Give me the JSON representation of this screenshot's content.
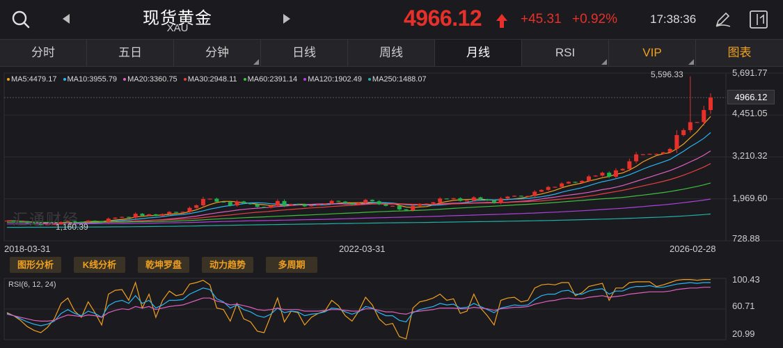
{
  "header": {
    "title": "现货黄金",
    "symbol": "XAU",
    "price": "4966.12",
    "change": "+45.31",
    "change_pct": "+0.92%",
    "time": "17:38:36",
    "colors": {
      "up": "#e8302a",
      "down": "#22b14c",
      "accent": "#f0a020"
    }
  },
  "icons": {
    "search": "search-icon",
    "prev": "chevron-left-icon",
    "next": "chevron-right-icon",
    "up_arrow": "arrow-up-icon",
    "draw": "pen-icon",
    "layout": "window-toggle-icon"
  },
  "tabs": [
    {
      "label": "分时",
      "active": false
    },
    {
      "label": "五日",
      "active": false
    },
    {
      "label": "分钟",
      "active": false
    },
    {
      "label": "日线",
      "active": false
    },
    {
      "label": "周线",
      "active": false
    },
    {
      "label": "月线",
      "active": true
    },
    {
      "label": "RSI",
      "active": false
    },
    {
      "label": "VIP",
      "active": false
    },
    {
      "label": "图表",
      "active": false
    }
  ],
  "ma": [
    {
      "label": "MA5:4479.17",
      "color": "#f0a020"
    },
    {
      "label": "MA10:3955.79",
      "color": "#29b6f6"
    },
    {
      "label": "MA20:3360.75",
      "color": "#e060c0"
    },
    {
      "label": "MA30:2948.11",
      "color": "#e84040"
    },
    {
      "label": "MA60:2391.14",
      "color": "#40c040"
    },
    {
      "label": "MA120:1902.49",
      "color": "#b040e0"
    },
    {
      "label": "MA250:1488.07",
      "color": "#20b0a8"
    }
  ],
  "y_axis": [
    "5,691.77",
    "4,451.05",
    "3,210.32",
    "1,969.60",
    "728.88"
  ],
  "current_price_tag": "4966.12",
  "annotations": {
    "high": "5,596.33",
    "low": "1,160.39"
  },
  "x_axis": [
    "2018-03-31",
    "2022-03-31",
    "2026-02-28"
  ],
  "watermark": "汇通财经",
  "tools": [
    "图形分析",
    "K线分析",
    "乾坤罗盘",
    "动力趋势",
    "多周期"
  ],
  "rsi": {
    "title": "RSI(6, 12, 24)",
    "y_axis": [
      "100.43",
      "60.71",
      "20.99"
    ]
  },
  "chart_data": {
    "type": "candlestick",
    "y_range": [
      728.88,
      5691.77
    ],
    "x_range": [
      "2018-03-31",
      "2026-02-28"
    ],
    "ticks": [
      "5,691.77",
      "4,451.05",
      "3,210.32",
      "1,969.60",
      "728.88"
    ],
    "last_close": 4966.12,
    "high": 5596.33,
    "low": 1160.39,
    "closes": [
      1325,
      1315,
      1300,
      1255,
      1223,
      1200,
      1215,
      1223,
      1282,
      1312,
      1292,
      1283,
      1325,
      1310,
      1284,
      1385,
      1414,
      1437,
      1413,
      1530,
      1472,
      1512,
      1465,
      1520,
      1584,
      1576,
      1589,
      1703,
      1780,
      1966,
      1975,
      1886,
      1878,
      1776,
      1894,
      1840,
      1810,
      1735,
      1707,
      1769,
      1906,
      1770,
      1814,
      1810,
      1750,
      1782,
      1801,
      1826,
      1911,
      1890,
      1838,
      1798,
      1850,
      1940,
      1900,
      1812,
      1763,
      1765,
      1660,
      1634,
      1766,
      1823,
      1830,
      1869,
      1980,
      1960,
      1990,
      1911,
      1920,
      2015,
      1960,
      1920,
      1848,
      1983,
      2036,
      2062,
      2040,
      2056,
      2182,
      2235,
      2322,
      2326,
      2426,
      2473,
      2448,
      2503,
      2634,
      2659,
      2743,
      2625,
      2813,
      2857,
      3082,
      3286,
      3289,
      3302,
      3303,
      3348,
      3448,
      3858,
      4004,
      4239,
      4242,
      4598,
      4966
    ],
    "rsi_range": [
      20.99,
      100.43
    ],
    "rsi": {
      "rsi6": [
        56,
        52,
        46,
        38,
        33,
        30,
        37,
        48,
        68,
        75,
        58,
        50,
        70,
        56,
        40,
        80,
        85,
        86,
        72,
        95,
        62,
        80,
        50,
        72,
        84,
        78,
        80,
        93,
        95,
        98,
        92,
        62,
        60,
        45,
        68,
        48,
        44,
        32,
        30,
        52,
        75,
        44,
        58,
        56,
        40,
        50,
        55,
        58,
        72,
        65,
        52,
        45,
        58,
        76,
        66,
        48,
        40,
        42,
        25,
        22,
        62,
        70,
        72,
        75,
        80,
        72,
        74,
        55,
        58,
        80,
        62,
        52,
        40,
        72,
        75,
        76,
        70,
        72,
        88,
        92,
        93,
        92,
        95,
        95,
        78,
        82,
        90,
        92,
        94,
        72,
        88,
        88,
        95,
        96,
        96,
        96,
        90,
        92,
        95,
        98,
        99,
        99,
        98,
        99,
        99
      ],
      "rsi12": [
        55,
        52,
        48,
        44,
        41,
        39,
        41,
        45,
        55,
        60,
        55,
        52,
        58,
        55,
        50,
        65,
        70,
        72,
        68,
        78,
        68,
        72,
        62,
        66,
        72,
        72,
        73,
        80,
        84,
        88,
        86,
        74,
        70,
        62,
        66,
        60,
        57,
        52,
        50,
        54,
        62,
        56,
        58,
        57,
        52,
        54,
        55,
        57,
        62,
        61,
        57,
        54,
        57,
        64,
        62,
        56,
        52,
        52,
        46,
        44,
        56,
        60,
        62,
        64,
        68,
        66,
        67,
        62,
        63,
        68,
        64,
        60,
        56,
        62,
        64,
        66,
        65,
        66,
        73,
        78,
        80,
        80,
        84,
        85,
        80,
        80,
        84,
        86,
        87,
        80,
        84,
        84,
        88,
        90,
        90,
        91,
        89,
        89,
        91,
        93,
        94,
        95,
        94,
        95,
        95
      ],
      "rsi24": [
        54,
        52,
        50,
        48,
        46,
        45,
        45,
        46,
        50,
        53,
        52,
        51,
        53,
        52,
        50,
        56,
        59,
        61,
        60,
        64,
        62,
        64,
        60,
        62,
        64,
        65,
        66,
        69,
        72,
        75,
        75,
        71,
        69,
        66,
        67,
        65,
        63,
        60,
        59,
        60,
        62,
        60,
        60,
        60,
        58,
        58,
        58,
        59,
        60,
        60,
        59,
        58,
        58,
        61,
        61,
        59,
        57,
        57,
        55,
        54,
        57,
        58,
        59,
        60,
        62,
        62,
        62,
        61,
        61,
        63,
        62,
        61,
        59,
        61,
        62,
        63,
        63,
        64,
        67,
        69,
        71,
        72,
        74,
        75,
        74,
        74,
        76,
        77,
        78,
        76,
        77,
        78,
        80,
        81,
        82,
        83,
        83,
        83,
        84,
        86,
        87,
        88,
        88,
        89,
        89
      ]
    }
  }
}
